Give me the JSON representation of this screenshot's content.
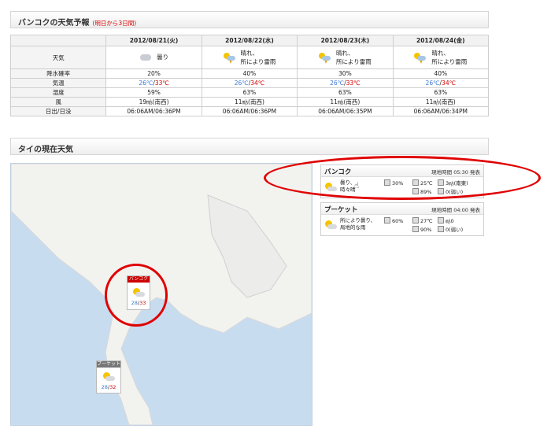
{
  "forecast": {
    "title": "バンコクの天気予報",
    "subtitle": "(明日から3日間)",
    "dates": [
      "2012/08/21(火)",
      "2012/08/22(水)",
      "2012/08/23(木)",
      "2012/08/24(金)"
    ],
    "row_labels": [
      "天気",
      "降水確率",
      "気温",
      "湿度",
      "風",
      "日出/日没"
    ],
    "weather": [
      {
        "icon": "cloud-icon",
        "line1": "曇り",
        "line2": ""
      },
      {
        "icon": "sun-rain-thunder-icon",
        "line1": "晴れ、",
        "line2": "所により雷雨"
      },
      {
        "icon": "sun-rain-thunder-icon",
        "line1": "晴れ、",
        "line2": "所により雷雨"
      },
      {
        "icon": "sun-rain-thunder-icon",
        "line1": "晴れ、",
        "line2": "所により雷雨"
      }
    ],
    "precip": [
      "20%",
      "40%",
      "30%",
      "40%"
    ],
    "temp_low": [
      "26℃",
      "26℃",
      "26℃",
      "26℃"
    ],
    "temp_high": [
      "33℃",
      "34℃",
      "33℃",
      "34℃"
    ],
    "humidity": [
      "59%",
      "63%",
      "63%",
      "63%"
    ],
    "wind": [
      "19㎧(南西)",
      "11㎧(南西)",
      "11㎧(南西)",
      "11㎧(南西)"
    ],
    "sun": [
      "06:06AM/06:36PM",
      "06:06AM/06:36PM",
      "06:06AM/06:35PM",
      "06:06AM/06:34PM"
    ]
  },
  "current": {
    "title": "タイの現在天気",
    "map_pins": [
      {
        "name": "バンコク",
        "low": "28",
        "high": "33",
        "color": "#cc0000"
      },
      {
        "name": "プーケット",
        "low": "28",
        "high": "32",
        "color": "#666666"
      }
    ],
    "panels": [
      {
        "city": "バンコク",
        "local_time": "現地時間 05:30 発表",
        "icon": "sunny-cloud-icon",
        "desc1": "曇り、",
        "desc2": "時々晴",
        "precip": "30%",
        "temp": "25℃",
        "wind": "3㎧(南東)",
        "humidity": "89%",
        "wind_level": "0(弱い)"
      },
      {
        "city": "プーケット",
        "local_time": "現地時間 04:00 発表",
        "icon": "sunny-cloud-icon",
        "desc1": "所により曇り、",
        "desc2": "局地的な雨",
        "precip": "60%",
        "temp": "27℃",
        "wind": "㎧0",
        "humidity": "90%",
        "wind_level": "0(弱い)"
      }
    ]
  },
  "colors": {
    "highlight": "#e00000",
    "low_temp": "#3c7bd6",
    "high_temp": "#d40000"
  }
}
